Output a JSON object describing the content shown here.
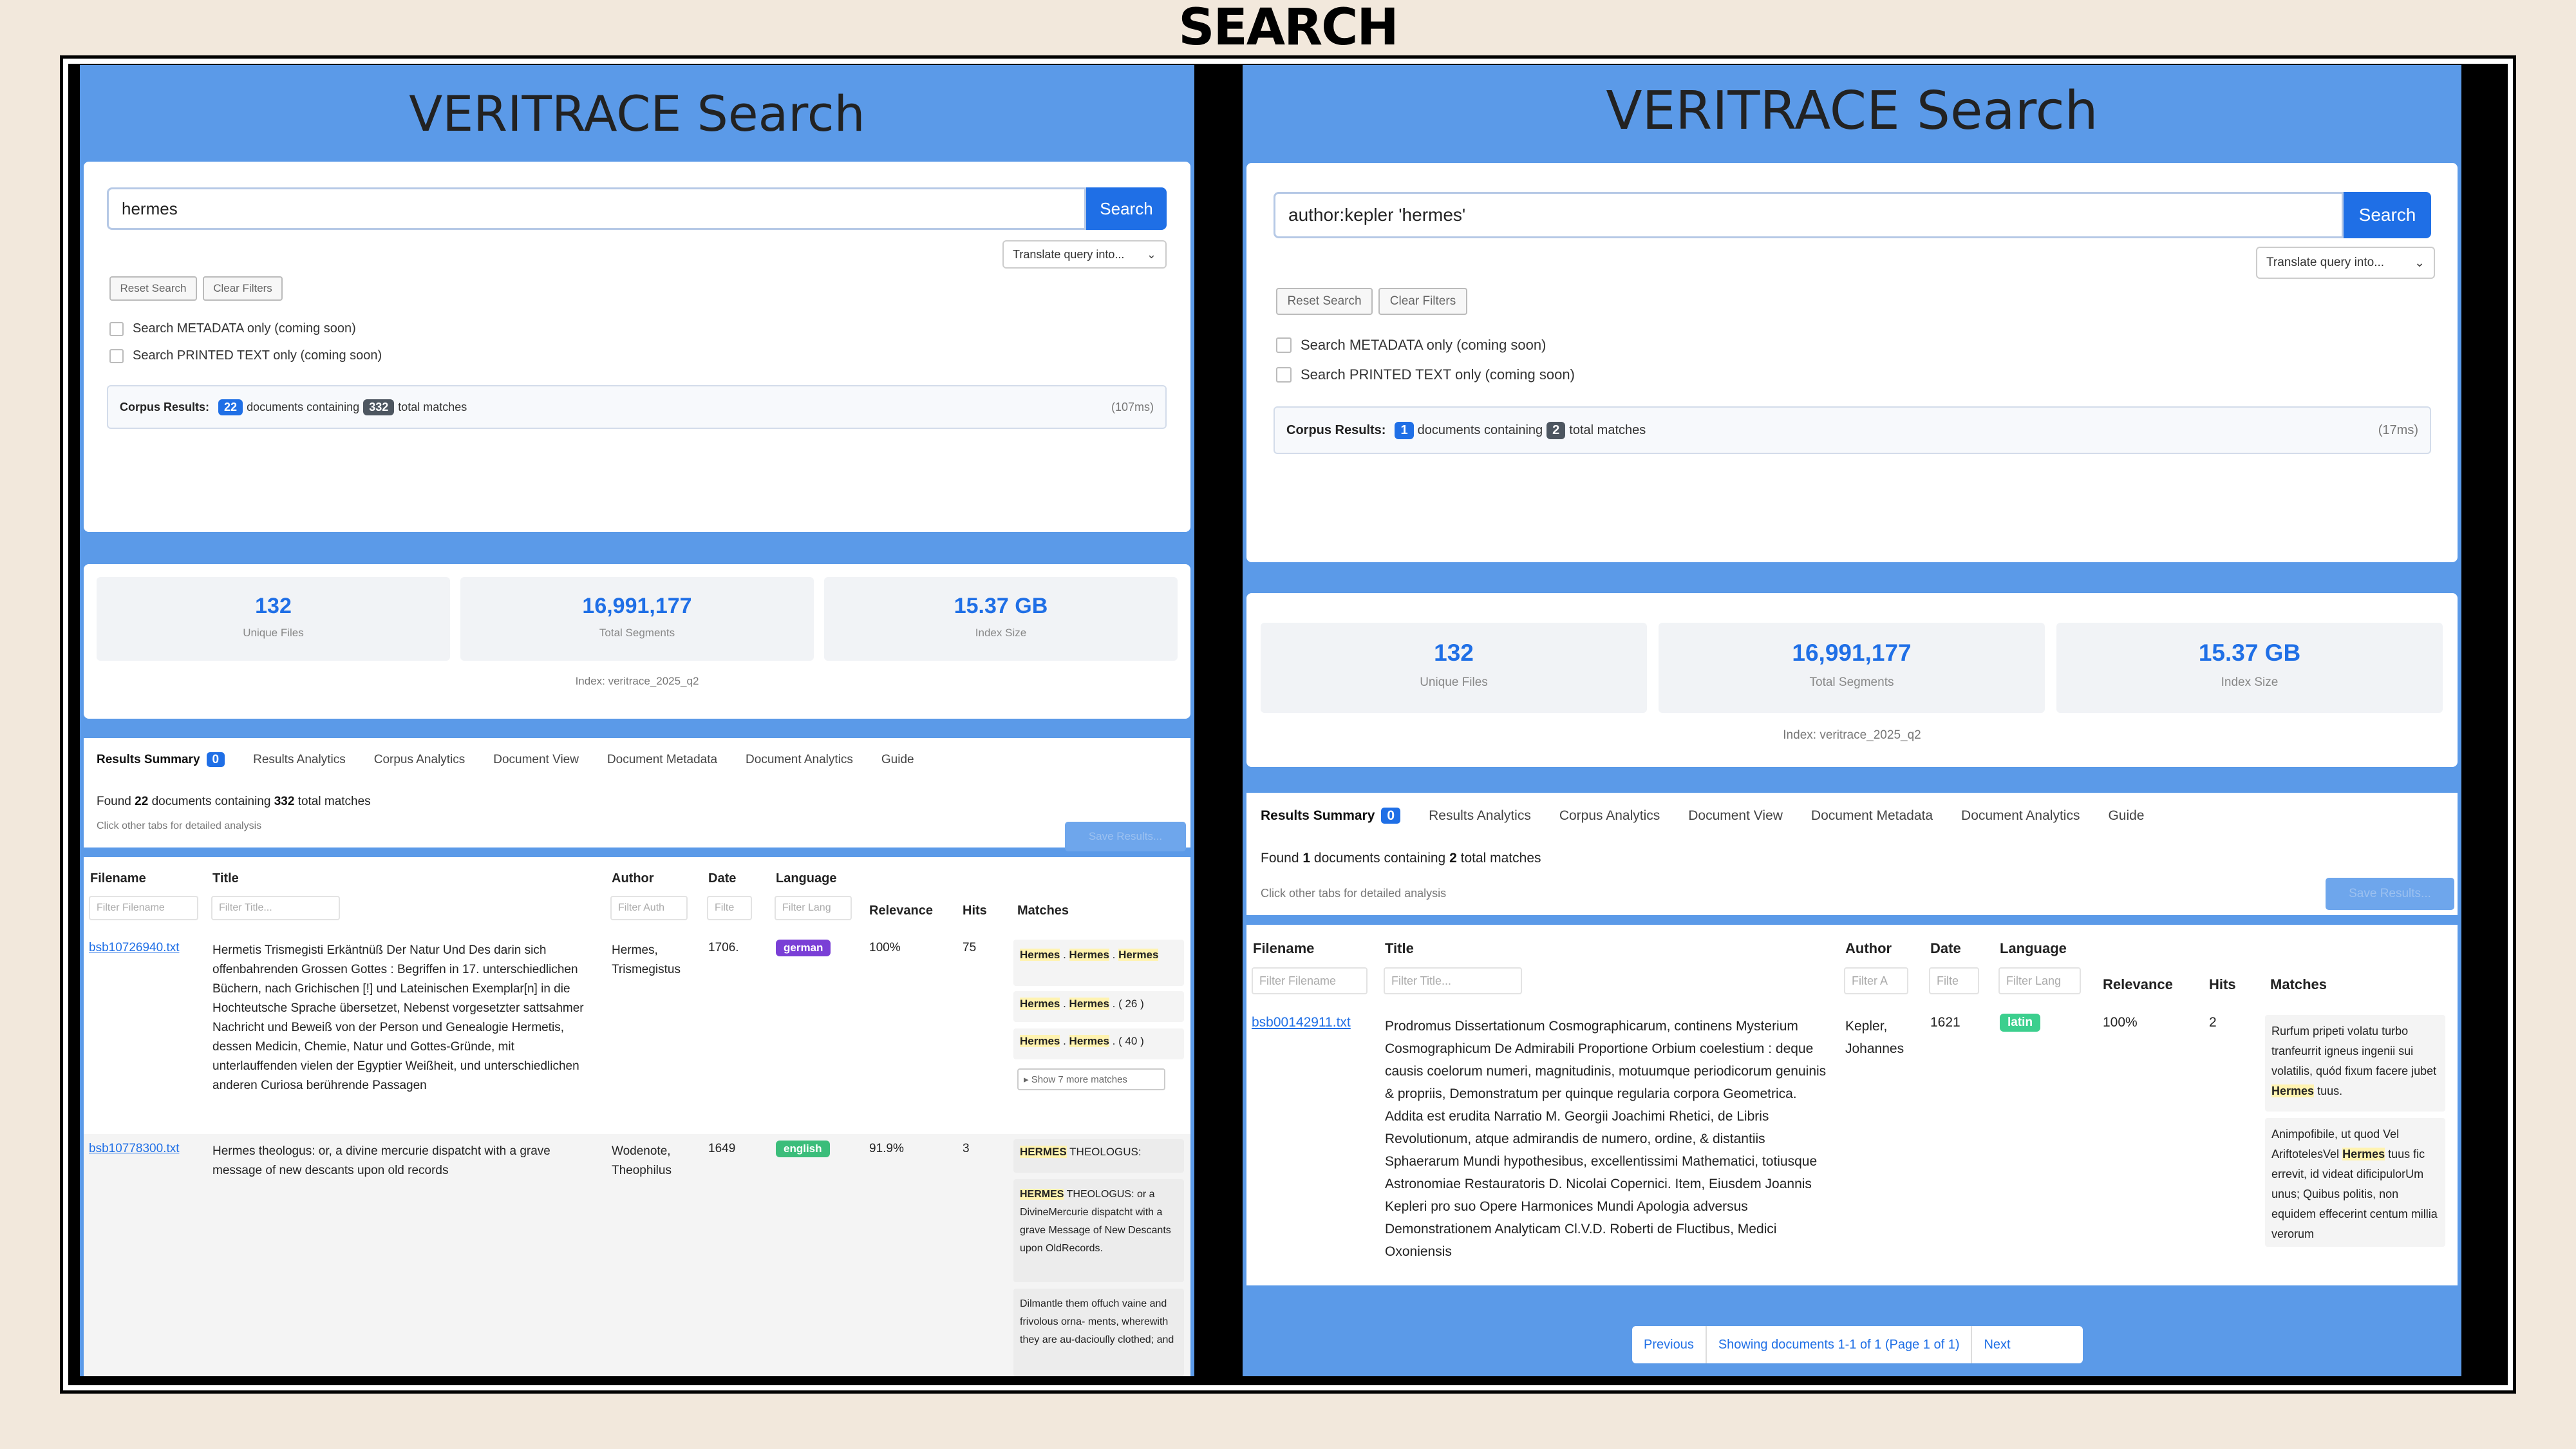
{
  "slide_title": "SEARCH",
  "app_title": "VERITRACE Search",
  "search_button": "Search",
  "translate_label": "Translate query into...",
  "reset_search": "Reset Search",
  "clear_filters": "Clear Filters",
  "metadata_only": "Search METADATA only (coming soon)",
  "printed_text_only": "Search PRINTED TEXT only (coming soon)",
  "corpus_results_label": "Corpus Results:",
  "documents_containing": "documents containing",
  "total_matches": "total matches",
  "stats": [
    {
      "value": "132",
      "label": "Unique Files"
    },
    {
      "value": "16,991,177",
      "label": "Total Segments"
    },
    {
      "value": "15.37 GB",
      "label": "Index Size"
    }
  ],
  "index_label": "Index: veritrace_2025_q2",
  "tabs": [
    "Results Summary",
    "Results Analytics",
    "Corpus Analytics",
    "Document View",
    "Document Metadata",
    "Document Analytics",
    "Guide"
  ],
  "tab_badge": "0",
  "click_hint": "Click other tabs for detailed analysis",
  "save_results": "Save Results...",
  "columns": {
    "filename": "Filename",
    "title": "Title",
    "author": "Author",
    "date": "Date",
    "language": "Language",
    "relevance": "Relevance",
    "hits": "Hits",
    "matches": "Matches"
  },
  "filters": {
    "filename": "Filter Filename",
    "title": "Filter Title...",
    "author": "Filter Auth",
    "author_short": "Filter A",
    "date": "Filte",
    "language": "Filter Lang"
  },
  "left": {
    "query": "hermes",
    "docs": "22",
    "matches": "332",
    "time": "(107ms)",
    "found_prefix": "Found",
    "found_docs": "22",
    "found_mid": "documents containing",
    "found_matches": "332",
    "found_suffix": "total matches",
    "rows": [
      {
        "filename": "bsb10726940.txt",
        "title": "Hermetis Trismegisti Erkäntnüß Der Natur Und Des darin sich offenbahrenden Grossen Gottes : Begriffen in 17. unterschiedlichen Büchern, nach Grichischen [!] und Lateinischen Exemplar[n] in die Hochteutsche Sprache übersetzet, Nebenst vorgesetzter sattsahmer Nachricht und Beweiß von der Person und Genealogie Hermetis, dessen Medicin, Chemie, Natur und Gottes-Gründe, mit unterlauffenden vielen der Egyptier Weißheit, und unterschiedlichen anderen Curiosa berührende Passagen",
        "author": "Hermes, Trismegistus",
        "date": "1706.",
        "language": "german",
        "relevance": "100%",
        "hits": "75",
        "match_kw": "Hermes",
        "match_count_1": "( 26 )",
        "match_count_2": "( 40 )",
        "show_more": "▸ Show 7 more matches"
      },
      {
        "filename": "bsb10778300.txt",
        "title": "Hermes theologus: or, a divine mercurie dispatcht with a grave message of new descants upon old records",
        "author": "Wodenote, Theophilus",
        "date": "1649",
        "language": "english",
        "relevance": "91.9%",
        "hits": "3",
        "match_1_kw": "HERMES",
        "match_1_rest": "THEOLOGUS:",
        "match_2_kw": "HERMES",
        "match_2_rest": "THEOLOGUS: or a DivineMercurie dispatcht with a grave Message of New Descants upon OldRecords.",
        "match_3": "Dilmantle them offuch vaine and frivolous orna- ments, wherewith they are au-daciouſly clothed; and"
      }
    ]
  },
  "right": {
    "query": "author:kepler 'hermes'",
    "docs": "1",
    "matches": "2",
    "time": "(17ms)",
    "found_prefix": "Found",
    "found_docs": "1",
    "found_mid": "documents containing",
    "found_matches": "2",
    "found_suffix": "total matches",
    "row": {
      "filename": "bsb00142911.txt",
      "title": "Prodromus Dissertationum Cosmographicarum, continens Mysterium Cosmographicum De Admirabili Proportione Orbium coelestium : deque causis coelorum numeri, magnitudinis, motuumque periodicorum genuinis & propriis, Demonstratum per quinque regularia corpora Geometrica. Addita est erudita Narratio M. Georgii Joachimi Rhetici, de Libris Revolutionum, atque admirandis de numero, ordine, & distantiis Sphaerarum Mundi hypothesibus, excellentissimi Mathematici, totiusque Astronomiae Restauratoris D. Nicolai Copernici. Item, Eiusdem Joannis Kepleri pro suo Opere Harmonices Mundi Apologia adversus Demonstrationem Analyticam Cl.V.D. Roberti de Fluctibus, Medici Oxoniensis",
      "author": "Kepler, Johannes",
      "date": "1621",
      "language": "latin",
      "relevance": "100%",
      "hits": "2",
      "match_1_pre": "Rurfum pripeti volatu turbo tranfeurrit igneus ingenii sui volatilis, quód fixum facere jubet",
      "match_1_kw": "Hermes",
      "match_1_post": "tuus.",
      "match_2_pre": "Animpofibile, ut quod Vel AriftotelesVel",
      "match_2_kw": "Hermes",
      "match_2_post": "tuus fic errevit, id videat dificipulorUm unus; Quibus politis, non equidem effecerint centum millia verorum"
    },
    "pager": {
      "previous": "Previous",
      "showing": "Showing documents 1-1 of 1 (Page 1 of 1)",
      "next": "Next"
    }
  },
  "colors": {
    "panel_blue": "#5b9ae8",
    "accent": "#1f6fe6",
    "german": "#7a3fd6",
    "english": "#3bbd7a",
    "latin": "#3ccf8e"
  }
}
